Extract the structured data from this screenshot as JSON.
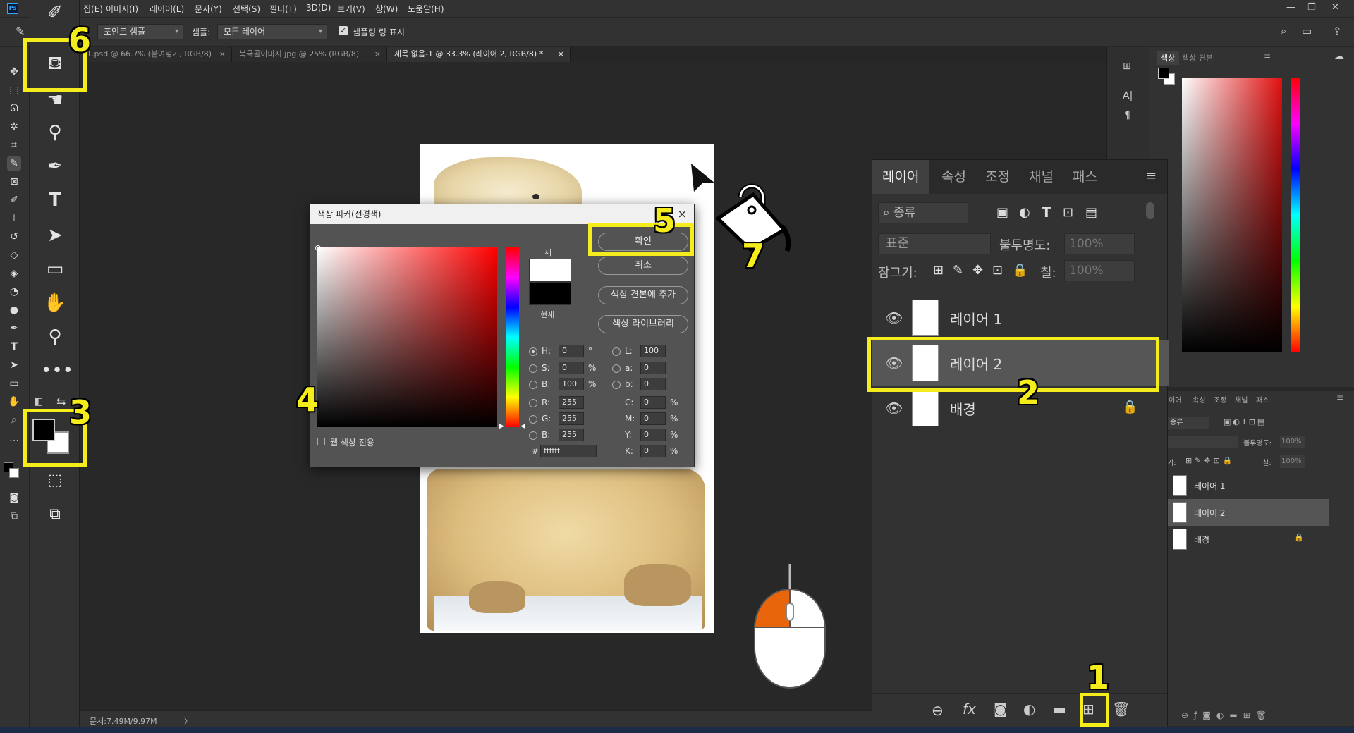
{
  "menubar": {
    "items": [
      "집(E)",
      "이미지(I)",
      "레이어(L)",
      "문자(Y)",
      "선택(S)",
      "필터(T)",
      "3D(D)",
      "보기(V)",
      "창(W)",
      "도움말(H)"
    ]
  },
  "options": {
    "sample_size": "포인트 샘플",
    "sample_label": "샘플:",
    "sample_value": "모든 레이어",
    "show_ring": "샘플링 링 표시"
  },
  "tabs": [
    {
      "label": "1.psd @ 66.7% (붙여넣기, RGB/8)",
      "close": "×"
    },
    {
      "label": "북극곰이미지.jpg @ 25% (RGB/8)",
      "close": "×"
    },
    {
      "label": "제목 없음-1 @ 33.3% (레이어 2, RGB/8) *",
      "close": "×"
    }
  ],
  "status": {
    "doc_size": "문서:7.49M/9.97M",
    "arrow": "〉"
  },
  "color_panel": {
    "tab_color": "색상",
    "tab_swatches": "색상 견본"
  },
  "layers_panel": {
    "tabs": [
      "레이어",
      "속성",
      "조정",
      "채널",
      "패스"
    ],
    "filter_label": "종류",
    "blend_mode": "표준",
    "opacity_label": "불투명도:",
    "opacity_value": "100%",
    "lock_label": "잠그기:",
    "fill_label": "칠:",
    "fill_value": "100%",
    "layers": [
      {
        "name": "레이어 1"
      },
      {
        "name": "레이어 2"
      },
      {
        "name": "배경"
      }
    ]
  },
  "small_layers_panel": {
    "tabs": [
      "이어",
      "속성",
      "조정",
      "채널",
      "패스"
    ],
    "filter_label": "종류",
    "opacity_label": "불투명도:",
    "opacity_value": "100%",
    "lock_label": "기:",
    "fill_label": "칠:",
    "fill_value": "100%",
    "layers": [
      "레이어 1",
      "레이어 2",
      "배경"
    ]
  },
  "color_picker": {
    "title": "색상 피커(전경색)",
    "close": "×",
    "ok": "확인",
    "cancel": "취소",
    "add_swatch": "색상 견본에 추가",
    "color_library": "색상 라이브러리",
    "new_label": "새",
    "current_label": "현재",
    "web_only": "웹 색상 전용",
    "fields_hsb": [
      {
        "label": "H:",
        "value": "0",
        "unit": "°"
      },
      {
        "label": "S:",
        "value": "0",
        "unit": "%"
      },
      {
        "label": "B:",
        "value": "100",
        "unit": "%"
      }
    ],
    "fields_rgb": [
      {
        "label": "R:",
        "value": "255"
      },
      {
        "label": "G:",
        "value": "255"
      },
      {
        "label": "B:",
        "value": "255"
      }
    ],
    "fields_lab": [
      {
        "label": "L:",
        "value": "100"
      },
      {
        "label": "a:",
        "value": "0"
      },
      {
        "label": "b:",
        "value": "0"
      }
    ],
    "fields_cmyk": [
      {
        "label": "C:",
        "value": "0",
        "unit": "%"
      },
      {
        "label": "M:",
        "value": "0",
        "unit": "%"
      },
      {
        "label": "Y:",
        "value": "0",
        "unit": "%"
      },
      {
        "label": "K:",
        "value": "0",
        "unit": "%"
      }
    ],
    "hex_label": "#",
    "hex_value": "ffffff"
  },
  "annotations": {
    "n1": "1",
    "n2": "2",
    "n3": "3",
    "n4": "4",
    "n5": "5",
    "n6": "6",
    "n7": "7",
    "highlight_color": "#f5ec1c"
  },
  "colors": {
    "foreground": "#000000",
    "background": "#ffffff",
    "accent_orange": "#e8650c"
  }
}
